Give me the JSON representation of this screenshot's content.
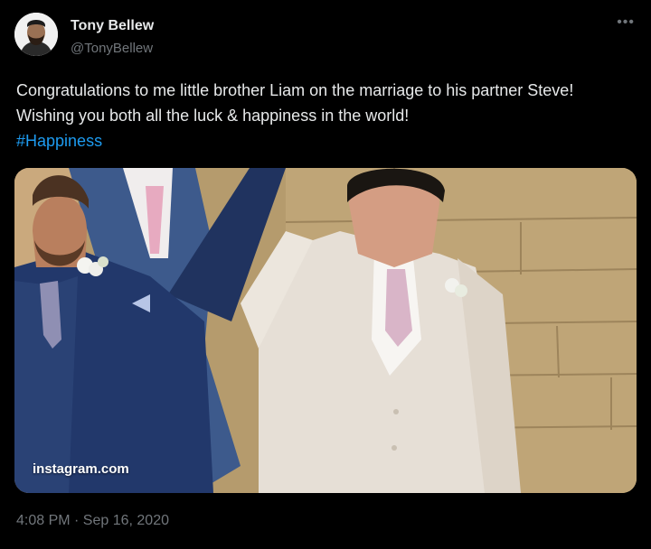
{
  "tweet": {
    "author_name": "Tony Bellew",
    "author_handle": "@TonyBellew",
    "more_icon": "more-horizontal-icon",
    "text": "Congratulations to me little brother Liam on the marriage to his partner Steve! Wishing you both all the luck & happiness in the world!",
    "hashtag": "#Happiness",
    "media_watermark": "instagram.com",
    "timestamp": "4:08 PM · Sep 16, 2020"
  },
  "colors": {
    "background": "#000000",
    "text_primary": "#e7e9ea",
    "text_secondary": "#71767b",
    "link": "#1d9bf0"
  }
}
